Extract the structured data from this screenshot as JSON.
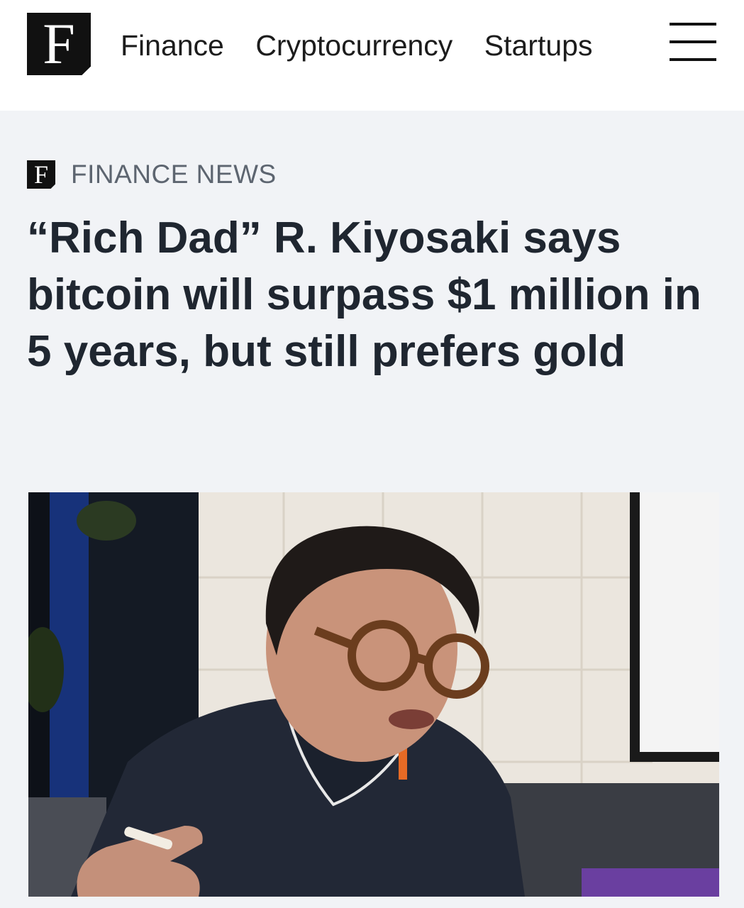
{
  "header": {
    "logo_letter": "F",
    "nav": [
      "Finance",
      "Cryptocurrency",
      "Startups"
    ],
    "menu_icon": "hamburger-menu-icon"
  },
  "article": {
    "section_logo_letter": "F",
    "section": "FINANCE NEWS",
    "headline": "“Rich Dad” R. Kiyosaki says bitcoin will surpass $1 million in 5 years, but still prefers gold"
  },
  "colors": {
    "header_bg": "#ffffff",
    "page_bg": "#f1f3f6",
    "logo_bg": "#111111",
    "headline": "#1f2630",
    "section_label": "#5d6570"
  }
}
